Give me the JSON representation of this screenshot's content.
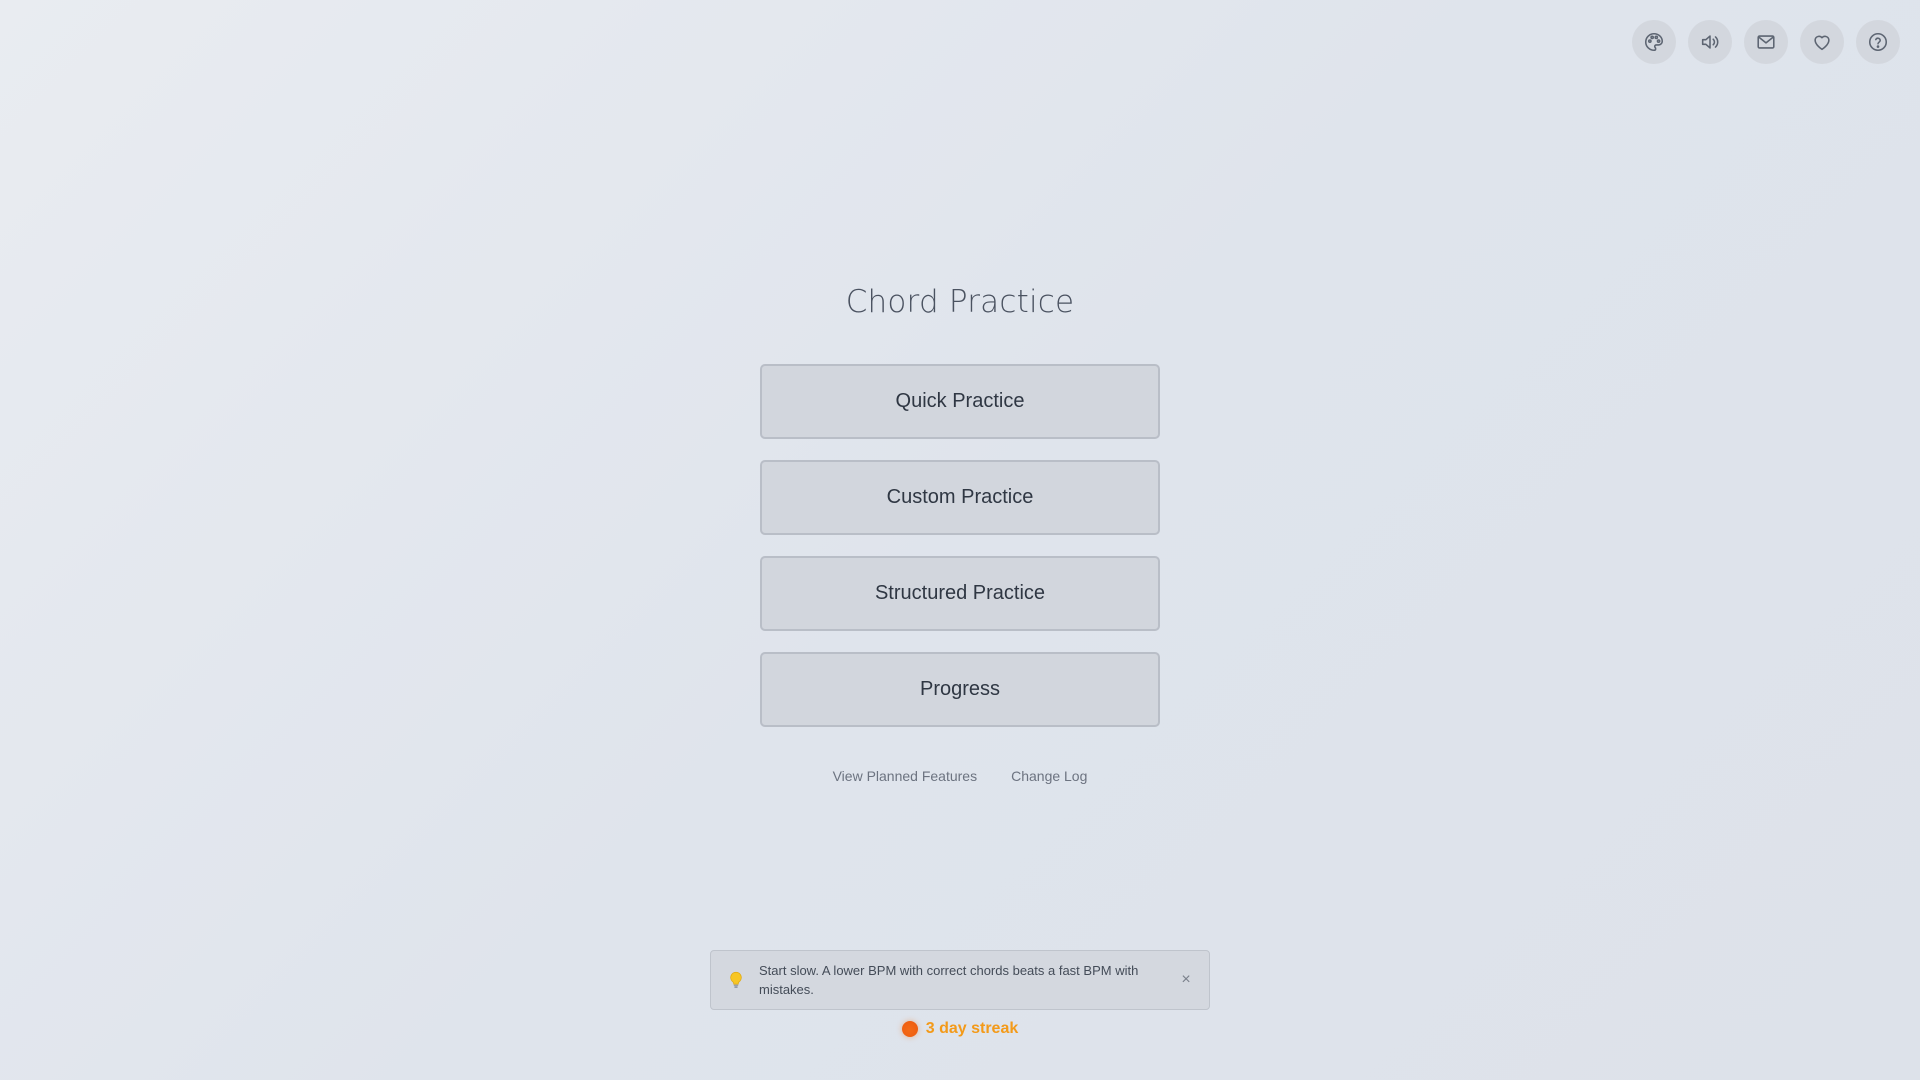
{
  "toolbar": {
    "icons": [
      "palette-icon",
      "volume-icon",
      "mail-icon",
      "heart-icon",
      "help-icon"
    ]
  },
  "title": "Chord Practice",
  "menu": {
    "quick": "Quick Practice",
    "custom": "Custom Practice",
    "structured": "Structured Practice",
    "progress": "Progress"
  },
  "links": {
    "planned": "View Planned Features",
    "changelog": "Change Log"
  },
  "tip": {
    "icon": "lightbulb-icon",
    "text": "Start slow. A lower BPM with correct chords beats a fast BPM with mistakes.",
    "close": "×"
  },
  "streak": {
    "icon": "flame-icon",
    "text": "3 day streak",
    "color": "#f39a19"
  },
  "colors": {
    "accent": "#f39a19",
    "button_bg": "#d2d6dd",
    "icon_bg": "#d3d7de"
  }
}
